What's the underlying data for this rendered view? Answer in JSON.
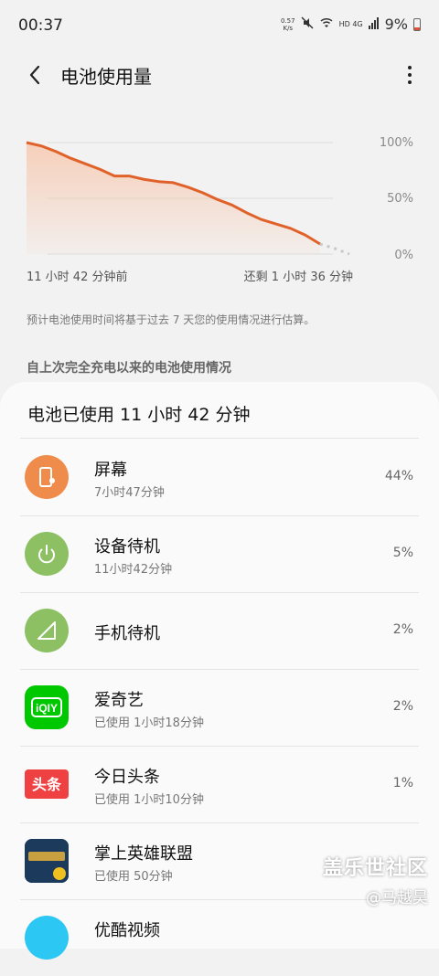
{
  "status_bar": {
    "time": "00:37",
    "net_speed_value": "0.57",
    "net_speed_unit": "K/s",
    "signal_label": "HD 4G",
    "battery_percent": "9%"
  },
  "header": {
    "title": "电池使用量"
  },
  "chart": {
    "y_labels": [
      "100%",
      "50%",
      "0%"
    ],
    "x_start_label": "11 小时 42 分钟前",
    "x_end_label": "还剩 1 小时 36 分钟",
    "colors": {
      "line": "#e0622a",
      "fill": "#f7c9b0",
      "projection": "#c8c8c8",
      "grid": "#dcdcdc"
    }
  },
  "chart_data": {
    "type": "line",
    "ylim": [
      0,
      100
    ],
    "series": [
      {
        "values": [
          100,
          97,
          92,
          86,
          81,
          76,
          70,
          70,
          67,
          65,
          64,
          60,
          55,
          49,
          44,
          37,
          31,
          27,
          23,
          17,
          9
        ]
      },
      {
        "values": [
          9,
          5,
          0
        ]
      }
    ]
  },
  "estimate_note": "预计电池使用时间将基于过去 7 天您的使用情况进行估算。",
  "section_header": "自上次完全充电以来的电池使用情况",
  "usage_card": {
    "title": "电池已使用 11 小时 42 分钟",
    "items": [
      {
        "name": "屏幕",
        "sub": "7小时47分钟",
        "percent": "44%",
        "icon": "screen-icon",
        "color": "#f08c4b"
      },
      {
        "name": "设备待机",
        "sub": "11小时42分钟",
        "percent": "5%",
        "icon": "power-icon",
        "color": "#8cc063"
      },
      {
        "name": "手机待机",
        "sub": "",
        "percent": "2%",
        "icon": "signal-icon",
        "color": "#8cc063"
      },
      {
        "name": "爱奇艺",
        "sub": "已使用 1小时18分钟",
        "percent": "2%",
        "icon": "iqiyi-icon",
        "color": "#00c800"
      },
      {
        "name": "今日头条",
        "sub": "已使用 1小时10分钟",
        "percent": "1%",
        "icon": "toutiao-icon",
        "color": "#f04142"
      },
      {
        "name": "掌上英雄联盟",
        "sub": "已使用 50分钟",
        "percent": "",
        "icon": "lol-icon",
        "color": "#1b3a5c"
      },
      {
        "name": "优酷视频",
        "sub": "",
        "percent": "",
        "icon": "youku-icon",
        "color": "#2dc7f4"
      }
    ]
  },
  "watermark": {
    "brand": "盖乐世社区",
    "user": "@马越昊"
  }
}
